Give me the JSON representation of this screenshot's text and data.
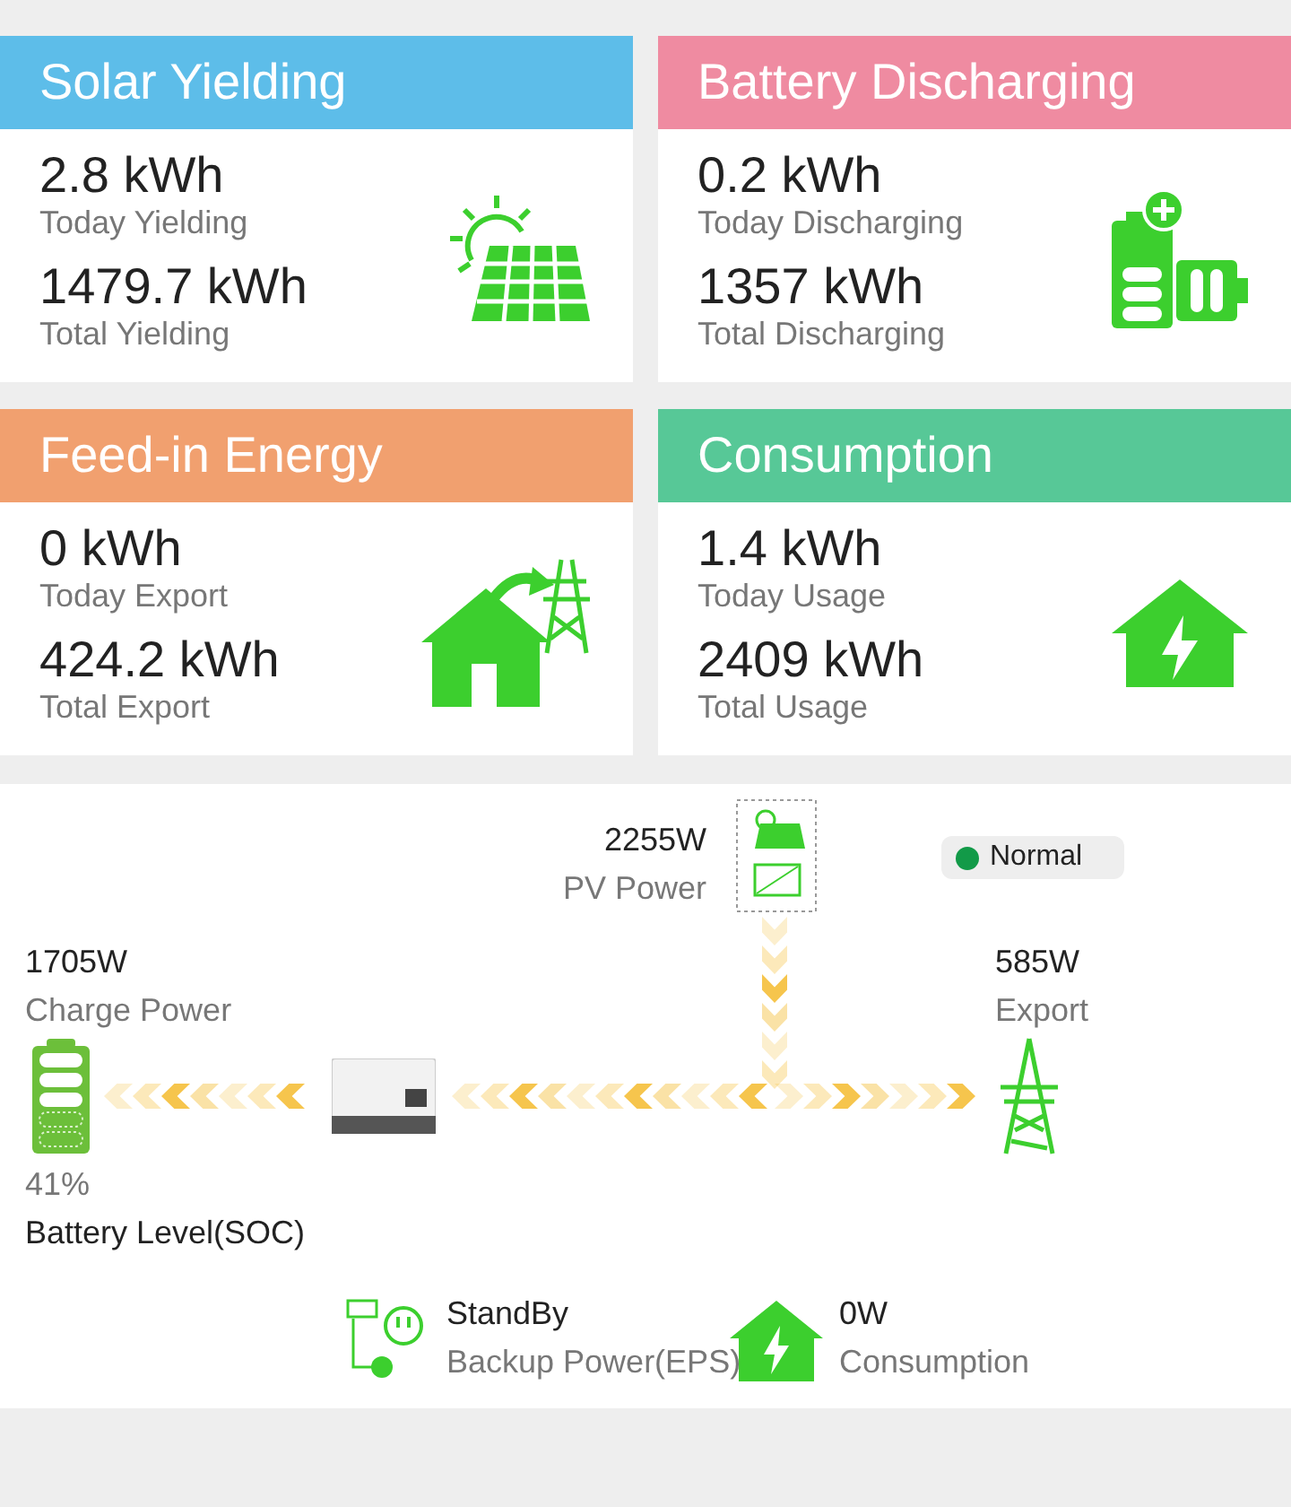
{
  "cards": [
    {
      "title": "Solar Yielding",
      "color": "#5dbde9",
      "kind": "solar",
      "metrics": [
        {
          "value": "2.8 kWh",
          "label": "Today Yielding"
        },
        {
          "value": "1479.7 kWh",
          "label": "Total Yielding"
        }
      ]
    },
    {
      "title": "Battery Discharging",
      "color": "#ef8ba1",
      "kind": "battery",
      "metrics": [
        {
          "value": "0.2 kWh",
          "label": "Today Discharging"
        },
        {
          "value": "1357 kWh",
          "label": "Total Discharging"
        }
      ]
    },
    {
      "title": "Feed-in Energy",
      "color": "#f1a06f",
      "kind": "feed",
      "metrics": [
        {
          "value": "0 kWh",
          "label": "Today Export"
        },
        {
          "value": "424.2 kWh",
          "label": "Total Export"
        }
      ]
    },
    {
      "title": "Consumption",
      "color": "#57c897",
      "kind": "home",
      "metrics": [
        {
          "value": "1.4 kWh",
          "label": "Today Usage"
        },
        {
          "value": "2409 kWh",
          "label": "Total Usage"
        }
      ]
    }
  ],
  "diagram": {
    "pv": {
      "value": "2255W",
      "label": "PV Power"
    },
    "status": {
      "label": "Normal",
      "color": "#129a48"
    },
    "battery": {
      "value": "1705W",
      "label": "Charge Power",
      "soc": "41%",
      "soc_label": "Battery Level(SOC)"
    },
    "grid": {
      "value": "585W",
      "label": "Export"
    },
    "eps": {
      "value": "StandBy",
      "label": "Backup Power(EPS)"
    },
    "load": {
      "value": "0W",
      "label": "Consumption"
    },
    "flows": [
      {
        "kind": "battery"
      },
      {
        "kind": "inverter"
      },
      {
        "kind": "grid"
      },
      {
        "kind": "pv"
      }
    ]
  }
}
